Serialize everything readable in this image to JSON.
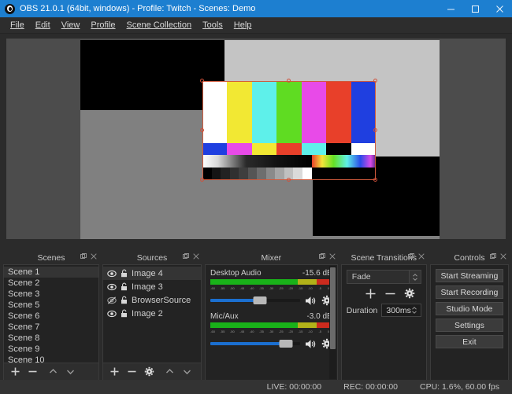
{
  "window": {
    "title": "OBS 21.0.1 (64bit, windows) - Profile: Twitch - Scenes: Demo",
    "logo_icon": "obs-logo-icon",
    "minimize_icon": "minimize-icon",
    "maximize_icon": "maximize-icon",
    "close_icon": "close-icon",
    "titlebar_color": "#1d7fd0"
  },
  "menubar": {
    "items": [
      {
        "label": "File",
        "accel": "F"
      },
      {
        "label": "Edit",
        "accel": "E"
      },
      {
        "label": "View",
        "accel": "V"
      },
      {
        "label": "Profile",
        "accel": "P"
      },
      {
        "label": "Scene Collection",
        "accel": "S"
      },
      {
        "label": "Tools",
        "accel": "T"
      },
      {
        "label": "Help",
        "accel": "H"
      }
    ]
  },
  "preview": {
    "name": "preview-canvas",
    "background_color": "#4c4c4c",
    "canvas_color": "#808080",
    "selection_color": "#d2503a",
    "rects": [
      {
        "name": "black-rect-top-left",
        "color": "#000000"
      },
      {
        "name": "light-gray-rect-top-right",
        "color": "#c4c4c4"
      },
      {
        "name": "black-rect-bottom-right",
        "color": "#000000"
      }
    ],
    "test_pattern": {
      "name": "smpte-color-bars",
      "top_bars": [
        "#ffffff",
        "#f2e833",
        "#5ef0ea",
        "#5fdc22",
        "#e84ae8",
        "#e8402a",
        "#1f3fe0"
      ],
      "mid_bars": [
        "#1f3fe0",
        "#e84ae8",
        "#f2e833",
        "#e8402a",
        "#5ef0ea",
        "#000000",
        "#ffffff"
      ],
      "gray_steps": [
        "#000000",
        "#141414",
        "#222222",
        "#303030",
        "#3e3e3e",
        "#555555",
        "#6e6e6e",
        "#8a8a8a",
        "#a5a5a5",
        "#c0c0c0",
        "#dadada",
        "#ffffff"
      ]
    }
  },
  "docks": {
    "scenes": {
      "title": "Scenes",
      "float_icon": "float-icon",
      "close_icon": "close-icon",
      "items": [
        "Scene 1",
        "Scene 2",
        "Scene 3",
        "Scene 5",
        "Scene 6",
        "Scene 7",
        "Scene 8",
        "Scene 9",
        "Scene 10"
      ],
      "selected_index": 0,
      "toolbar": [
        {
          "name": "add-scene-button",
          "icon": "plus-icon"
        },
        {
          "name": "remove-scene-button",
          "icon": "minus-icon"
        },
        {
          "name": "move-scene-up-button",
          "icon": "chevron-up-icon"
        },
        {
          "name": "move-scene-down-button",
          "icon": "chevron-down-icon"
        }
      ]
    },
    "sources": {
      "title": "Sources",
      "float_icon": "float-icon",
      "close_icon": "close-icon",
      "items": [
        {
          "label": "Image 4",
          "visible": true,
          "locked": false,
          "selected": true
        },
        {
          "label": "Image 3",
          "visible": true,
          "locked": false,
          "selected": false
        },
        {
          "label": "BrowserSource",
          "visible": false,
          "locked": false,
          "selected": false
        },
        {
          "label": "Image 2",
          "visible": true,
          "locked": false,
          "selected": false
        }
      ],
      "toolbar": [
        {
          "name": "add-source-button",
          "icon": "plus-icon"
        },
        {
          "name": "remove-source-button",
          "icon": "minus-icon"
        },
        {
          "name": "source-properties-button",
          "icon": "gear-icon"
        },
        {
          "name": "move-source-up-button",
          "icon": "chevron-up-icon"
        },
        {
          "name": "move-source-down-button",
          "icon": "chevron-down-icon"
        }
      ]
    },
    "mixer": {
      "title": "Mixer",
      "float_icon": "float-icon",
      "close_icon": "close-icon",
      "scale_ticks": [
        "-60",
        "-55",
        "-50",
        "-45",
        "-40",
        "-35",
        "-30",
        "-25",
        "-20",
        "-15",
        "-10",
        "-5",
        "0"
      ],
      "channels": [
        {
          "name": "Desktop Audio",
          "level": "-15.6 dB",
          "volume_percent": 55,
          "meter_green_percent": 72,
          "meter_yellow_percent": 15,
          "meter_red_percent": 13,
          "mute_icon": "speaker-icon",
          "settings_icon": "gear-icon"
        },
        {
          "name": "Mic/Aux",
          "level": "-3.0 dB",
          "volume_percent": 84,
          "meter_green_percent": 72,
          "meter_yellow_percent": 15,
          "meter_red_percent": 13,
          "mute_icon": "speaker-icon",
          "settings_icon": "gear-icon"
        }
      ]
    },
    "transitions": {
      "title": "Scene Transitions",
      "float_icon": "float-icon",
      "close_icon": "close-icon",
      "selected_transition": "Fade",
      "add_icon": "plus-icon",
      "remove_icon": "minus-icon",
      "properties_icon": "gear-icon",
      "duration_label": "Duration",
      "duration_value": "300ms"
    },
    "controls": {
      "title": "Controls",
      "float_icon": "float-icon",
      "close_icon": "close-icon",
      "buttons": [
        "Start Streaming",
        "Start Recording",
        "Studio Mode",
        "Settings",
        "Exit"
      ]
    }
  },
  "statusbar": {
    "live": "LIVE: 00:00:00",
    "rec": "REC: 00:00:00",
    "cpu": "CPU: 1.6%, 60.00 fps"
  }
}
